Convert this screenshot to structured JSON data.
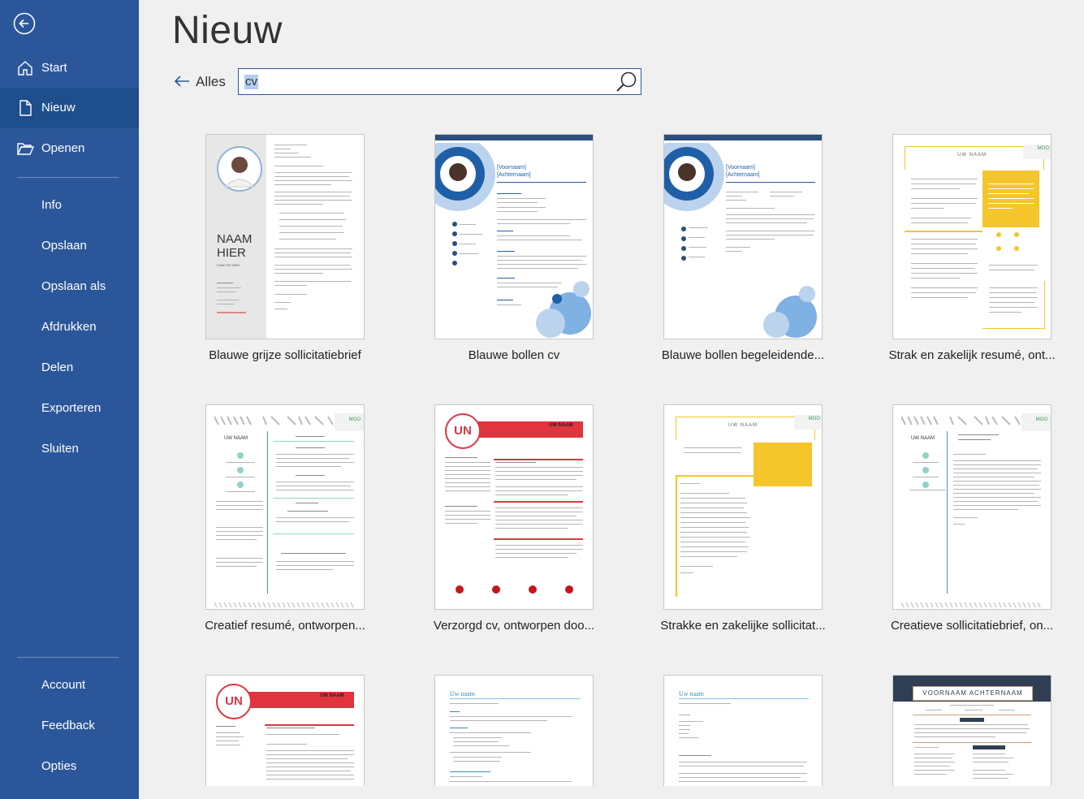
{
  "sidebar": {
    "items": [
      {
        "label": "Start"
      },
      {
        "label": "Nieuw"
      },
      {
        "label": "Openen"
      },
      {
        "label": "Info"
      },
      {
        "label": "Opslaan"
      },
      {
        "label": "Opslaan als"
      },
      {
        "label": "Afdrukken"
      },
      {
        "label": "Delen"
      },
      {
        "label": "Exporteren"
      },
      {
        "label": "Sluiten"
      },
      {
        "label": "Account"
      },
      {
        "label": "Feedback"
      },
      {
        "label": "Opties"
      }
    ]
  },
  "main": {
    "title": "Nieuw",
    "back_label": "Alles",
    "search_value": "cv"
  },
  "templates": [
    {
      "caption": "Blauwe grijze sollicitatiebrief",
      "name_line1": "NAAM",
      "name_line2": "HIER",
      "sub": "FUNCTIE HIER"
    },
    {
      "caption": "Blauwe bollen cv",
      "name_line1": "[Voornaam]",
      "name_line2": "[Achternaam]"
    },
    {
      "caption": "Blauwe bollen begeleidende...",
      "name_line1": "[Voornaam]",
      "name_line2": "[Achternaam]"
    },
    {
      "caption": "Strak en zakelijk resumé, ont...",
      "header": "UW NAAM",
      "moo": "MOO"
    },
    {
      "caption": "Creatief resumé, ontworpen...",
      "header": "UW NAAM",
      "moo": "MOO"
    },
    {
      "caption": "Verzorgd cv, ontworpen doo...",
      "monogram": "UN",
      "header": "UW NAAM"
    },
    {
      "caption": "Strakke en zakelijke sollicitat...",
      "header": "UW NAAM",
      "moo": "MOO"
    },
    {
      "caption": "Creatieve sollicitatiebrief, on...",
      "header": "UW NAAM",
      "moo": "MOO"
    },
    {
      "monogram": "UN",
      "header": "UW NAAM"
    },
    {
      "header": "Uw naam"
    },
    {
      "header": "Uw naam"
    },
    {
      "header": "VOORNAAM ACHTERNAAM"
    }
  ],
  "colors": {
    "sidebar": "#2b579a",
    "active": "#1e4e8c",
    "accent_blue": "#1f5fa8",
    "accent_red": "#e0343f",
    "accent_yellow": "#f5c52c",
    "accent_green": "#3a9a5b"
  }
}
